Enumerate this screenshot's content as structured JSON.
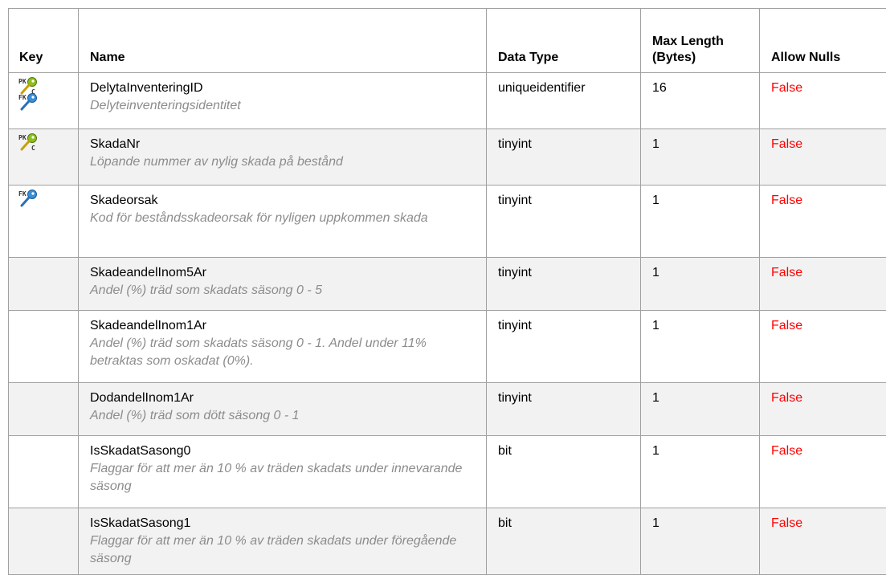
{
  "headers": {
    "key": "Key",
    "name": "Name",
    "data_type": "Data Type",
    "max_length_1": "Max Length",
    "max_length_2": "(Bytes)",
    "allow_nulls": "Allow Nulls"
  },
  "rows": [
    {
      "keys": [
        "pk-icon",
        "fk-icon"
      ],
      "name": "DelytaInventeringID",
      "description": "Delyteinventeringsidentitet",
      "data_type": "uniqueidentifier",
      "max_length": "16",
      "allow_nulls": "False"
    },
    {
      "keys": [
        "pk-icon"
      ],
      "name": "SkadaNr",
      "description": "Löpande nummer av nylig skada på bestånd",
      "data_type": "tinyint",
      "max_length": "1",
      "allow_nulls": "False"
    },
    {
      "keys": [
        "fk-icon"
      ],
      "name": "Skadeorsak",
      "description": "Kod för beståndsskadeorsak för nyligen uppkommen skada",
      "data_type": "tinyint",
      "max_length": "1",
      "allow_nulls": "False"
    },
    {
      "keys": [],
      "name": "SkadeandelInom5Ar",
      "description": "Andel (%) träd som skadats säsong 0 - 5",
      "data_type": "tinyint",
      "max_length": "1",
      "allow_nulls": "False"
    },
    {
      "keys": [],
      "name": "SkadeandelInom1Ar",
      "description": "Andel (%) träd som skadats säsong 0 - 1. Andel under 11% betraktas som oskadat (0%).",
      "data_type": "tinyint",
      "max_length": "1",
      "allow_nulls": "False"
    },
    {
      "keys": [],
      "name": "DodandelInom1Ar",
      "description": "Andel (%)  träd som dött säsong 0 - 1",
      "data_type": "tinyint",
      "max_length": "1",
      "allow_nulls": "False"
    },
    {
      "keys": [],
      "name": "IsSkadatSasong0",
      "description": "Flaggar för att mer än 10 % av träden skadats under innevarande säsong",
      "data_type": "bit",
      "max_length": "1",
      "allow_nulls": "False"
    },
    {
      "keys": [],
      "name": "IsSkadatSasong1",
      "description": "Flaggar för att mer än 10 % av träden skadats under föregående säsong",
      "data_type": "bit",
      "max_length": "1",
      "allow_nulls": "False"
    }
  ],
  "colors": {
    "pk_key": "#8fbf1f",
    "fk_key": "#3a8fd6",
    "false_text": "#ff0000",
    "description_text": "#8c8c8c"
  }
}
